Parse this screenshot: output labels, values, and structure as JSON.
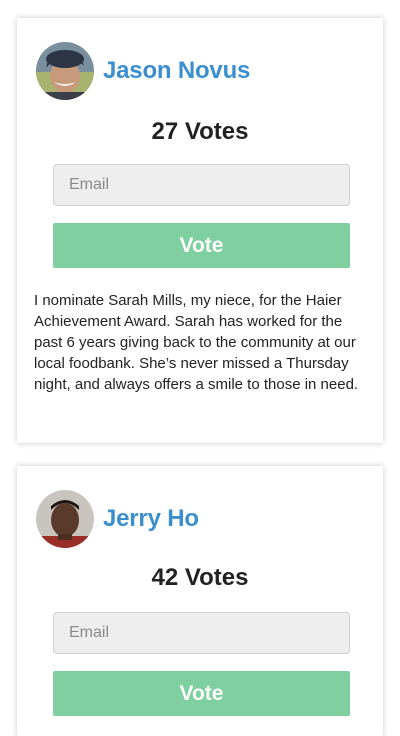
{
  "nominees": [
    {
      "name": "Jason Novus",
      "votes": "27 Votes",
      "email_placeholder": "Email",
      "email_value": "",
      "vote_label": "Vote",
      "description": "I nominate Sarah Mills, my niece, for the Haier Achievement Award. Sarah has worked for the past 6 years giving back to the community at our local foodbank. She’s never missed a Thursday night, and always offers a smile to those in need."
    },
    {
      "name": "Jerry Ho",
      "votes": "42 Votes",
      "email_placeholder": "Email",
      "email_value": "",
      "vote_label": "Vote"
    }
  ],
  "colors": {
    "name_link": "#3c8fce",
    "vote_button": "#80cfa1",
    "input_bg": "#eeeeee",
    "text": "#222222"
  }
}
